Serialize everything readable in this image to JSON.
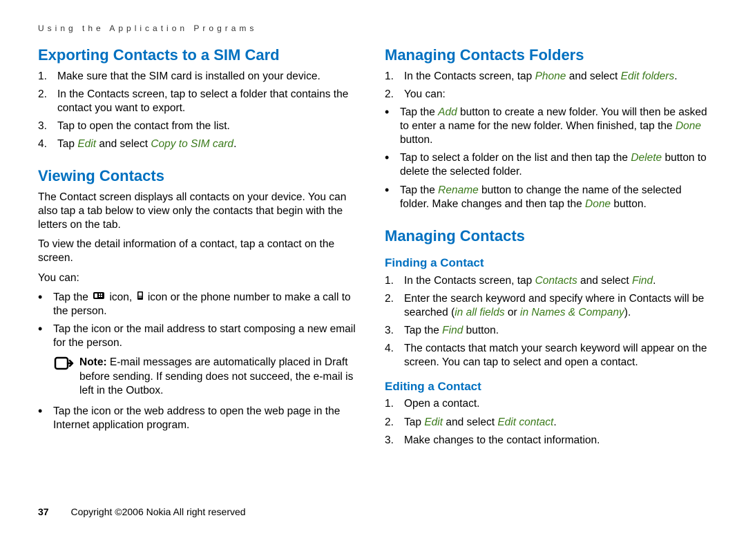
{
  "running_header": "Using the Application Programs",
  "left": {
    "h_export": "Exporting Contacts to a SIM Card",
    "export_steps": [
      "Make sure that the SIM card is installed on your device.",
      "In the Contacts screen, tap to select a folder that contains the contact you want to export.",
      "Tap to open the contact from the list."
    ],
    "export_step4_pre": "Tap ",
    "export_step4_edit": "Edit",
    "export_step4_mid": " and select ",
    "export_step4_copy": "Copy to SIM card",
    "export_step4_post": ".",
    "h_view": "Viewing Contacts",
    "view_p1": "The Contact screen displays all contacts on your device. You can also tap a tab below to view only the contacts that begin with the letters on the tab.",
    "view_p2": "To view the detail information of a contact, tap a contact on the screen.",
    "view_p3": "You can:",
    "view_b1_a": "Tap the ",
    "view_b1_b": " icon, ",
    "view_b1_c": " icon or the phone number to make a call to the person.",
    "view_b2": "Tap the      icon or the mail address to start composing a new email for the person.",
    "note_label": "Note:",
    "note_text": " E-mail messages are automatically placed in Draft before sending. If sending does not succeed, the e-mail is left in the Outbox.",
    "view_b3": "Tap the      icon or the web address to open the web page in the Internet application program."
  },
  "right": {
    "h_folders": "Managing Contacts Folders",
    "fold_s1_a": "In the Contacts screen, tap ",
    "fold_s1_phone": "Phone",
    "fold_s1_b": " and select ",
    "fold_s1_edit": "Edit folders",
    "fold_s1_c": ".",
    "fold_s2": "You can:",
    "fold_b1_a": "Tap the ",
    "fold_b1_add": "Add",
    "fold_b1_b": " button to create a new folder. You will then be asked to enter a name for the new folder. When finished, tap the ",
    "fold_b1_done": "Done",
    "fold_b1_c": " button.",
    "fold_b2_a": "Tap to select a folder on the list and then tap the ",
    "fold_b2_del": "Delete",
    "fold_b2_b": " button to delete the selected folder.",
    "fold_b3_a": "Tap the ",
    "fold_b3_ren": "Rename",
    "fold_b3_b": " button to change the name of the selected folder. Make changes and then tap the ",
    "fold_b3_done": "Done",
    "fold_b3_c": " button.",
    "h_manage": "Managing Contacts",
    "h_find": "Finding a Contact",
    "find_s1_a": "In the Contacts screen, tap ",
    "find_s1_contacts": "Contacts",
    "find_s1_b": " and select ",
    "find_s1_find": "Find",
    "find_s1_c": ".",
    "find_s2_a": "Enter the search keyword and specify where in Contacts will be searched (",
    "find_s2_all": "in all fields",
    "find_s2_b": " or ",
    "find_s2_names": "in Names & Company",
    "find_s2_c": ").",
    "find_s3_a": "Tap the ",
    "find_s3_find": "Find",
    "find_s3_b": " button.",
    "find_s4": "The contacts that match your search keyword will appear on the screen. You can tap to select and open a contact.",
    "h_edit": "Editing a Contact",
    "edit_s1": "Open a contact.",
    "edit_s2_a": "Tap ",
    "edit_s2_edit": "Edit",
    "edit_s2_b": " and select ",
    "edit_s2_editc": "Edit contact",
    "edit_s2_c": ".",
    "edit_s3": "Make changes to the contact information."
  },
  "footer": {
    "page": "37",
    "copyright": "Copyright ©2006 Nokia All right reserved"
  }
}
